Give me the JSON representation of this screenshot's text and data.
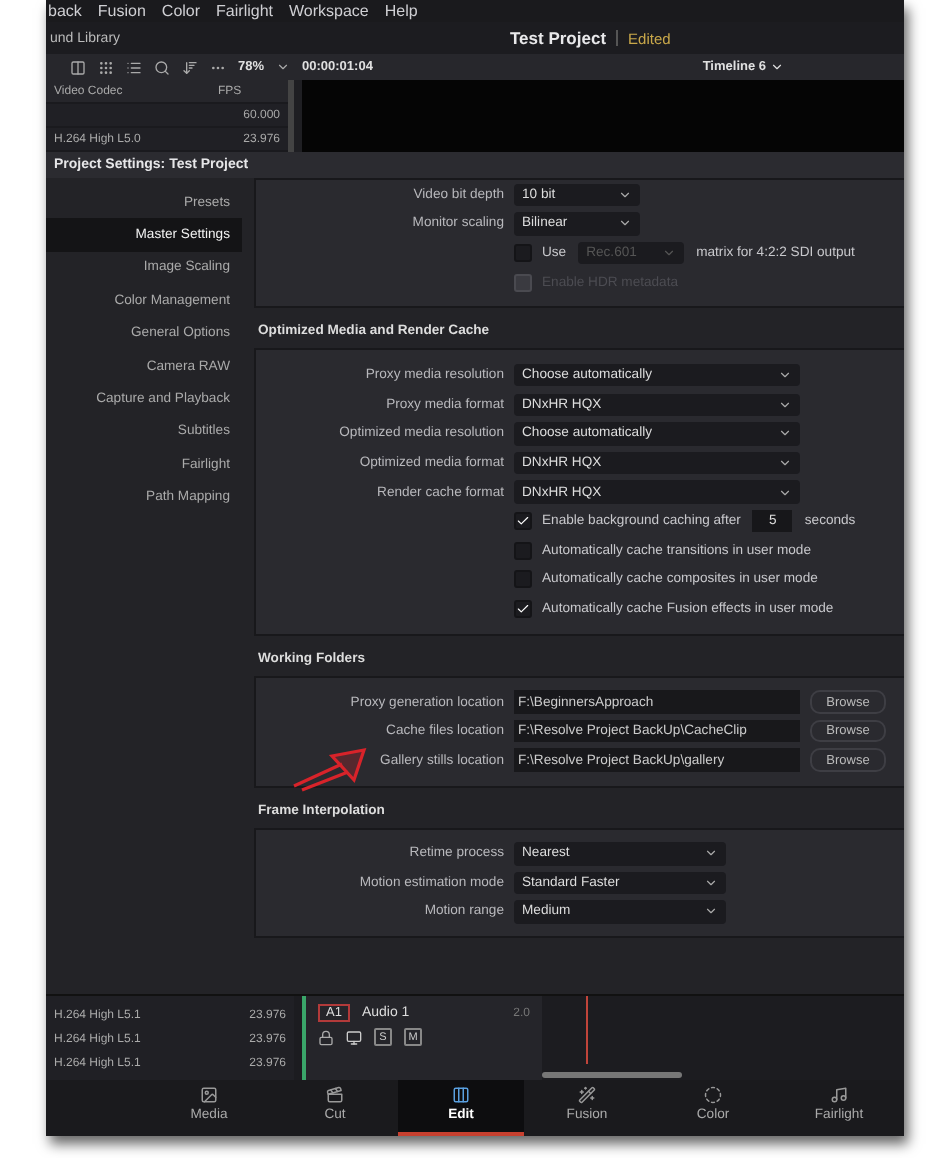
{
  "menu_bar": [
    "back",
    "Fusion",
    "Color",
    "Fairlight",
    "Workspace",
    "Help"
  ],
  "header": {
    "library": "und Library",
    "project": "Test Project",
    "status": "Edited"
  },
  "toolbar": {
    "zoom": "78%",
    "timecode": "00:00:01:04",
    "timeline": "Timeline 6"
  },
  "media_table": {
    "columns": [
      "Video Codec",
      "FPS"
    ],
    "rows": [
      {
        "fps": "60.000"
      },
      {
        "codec": "H.264 High L5.0",
        "fps": "23.976"
      }
    ]
  },
  "dialog": {
    "title": "Project Settings:  Test Project",
    "sidebar": [
      {
        "label": "Presets",
        "selected": false
      },
      {
        "label": "Master Settings",
        "selected": true
      },
      {
        "label": "Image Scaling",
        "selected": false
      },
      {
        "label": "Color Management",
        "selected": false
      },
      {
        "label": "General Options",
        "selected": false
      },
      {
        "label": "Camera RAW",
        "selected": false
      },
      {
        "label": "Capture and Playback",
        "selected": false
      },
      {
        "label": "Subtitles",
        "selected": false
      },
      {
        "label": "Fairlight",
        "selected": false
      },
      {
        "label": "Path Mapping",
        "selected": false
      }
    ],
    "sections": [
      {
        "rows": [
          {
            "kind": "dropdown",
            "label": "Video bit depth",
            "value": "10 bit"
          },
          {
            "kind": "dropdown",
            "label": "Monitor scaling",
            "value": "Bilinear"
          },
          {
            "kind": "matrix",
            "label": "Use",
            "checked": false,
            "value": "Rec.601",
            "suffix": "matrix for 4:2:2 SDI output"
          },
          {
            "kind": "checkbox",
            "label": "Enable HDR metadata",
            "checked": false,
            "disabled": true
          }
        ]
      },
      {
        "heading": "Optimized Media and Render Cache",
        "rows": [
          {
            "kind": "dropdown",
            "label": "Proxy media resolution",
            "value": "Choose automatically"
          },
          {
            "kind": "dropdown",
            "label": "Proxy media format",
            "value": "DNxHR HQX"
          },
          {
            "kind": "dropdown",
            "label": "Optimized media resolution",
            "value": "Choose automatically"
          },
          {
            "kind": "dropdown",
            "label": "Optimized media format",
            "value": "DNxHR HQX"
          },
          {
            "kind": "dropdown",
            "label": "Render cache format",
            "value": "DNxHR HQX"
          },
          {
            "kind": "timed_checkbox",
            "label": "Enable background caching after",
            "checked": true,
            "value": "5",
            "suffix": "seconds"
          },
          {
            "kind": "checkbox",
            "label": "Automatically cache transitions in user mode",
            "checked": false,
            "disabled": false
          },
          {
            "kind": "checkbox",
            "label": "Automatically cache composites in user mode",
            "checked": false,
            "disabled": false
          },
          {
            "kind": "checkbox",
            "label": "Automatically cache Fusion effects in user mode",
            "checked": true,
            "disabled": false
          }
        ]
      },
      {
        "heading": "Working Folders",
        "rows": [
          {
            "kind": "folder",
            "label": "Proxy generation location",
            "value": "F:\\BeginnersApproach",
            "button": "Browse"
          },
          {
            "kind": "folder",
            "label": "Cache files location",
            "value": "F:\\Resolve Project BackUp\\CacheClip",
            "button": "Browse"
          },
          {
            "kind": "folder",
            "label": "Gallery stills location",
            "value": "F:\\Resolve Project BackUp\\gallery",
            "button": "Browse"
          }
        ]
      },
      {
        "heading": "Frame Interpolation",
        "rows": [
          {
            "kind": "dropdown",
            "label": "Retime process",
            "value": "Nearest"
          },
          {
            "kind": "dropdown",
            "label": "Motion estimation mode",
            "value": "Standard Faster"
          },
          {
            "kind": "dropdown",
            "label": "Motion range",
            "value": "Medium"
          }
        ]
      }
    ]
  },
  "timeline": {
    "clips": [
      {
        "codec": "H.264 High L5.1",
        "fps": "23.976"
      },
      {
        "codec": "H.264 High L5.1",
        "fps": "23.976"
      },
      {
        "codec": "H.264 High L5.1",
        "fps": "23.976"
      }
    ],
    "track": {
      "id": "A1",
      "name": "Audio 1",
      "channels": "2.0",
      "buttons": [
        "S",
        "M"
      ]
    }
  },
  "pages": [
    {
      "label": "Media",
      "selected": false
    },
    {
      "label": "Cut",
      "selected": false
    },
    {
      "label": "Edit",
      "selected": true
    },
    {
      "label": "Fusion",
      "selected": false
    },
    {
      "label": "Color",
      "selected": false
    },
    {
      "label": "Fairlight",
      "selected": false
    }
  ]
}
